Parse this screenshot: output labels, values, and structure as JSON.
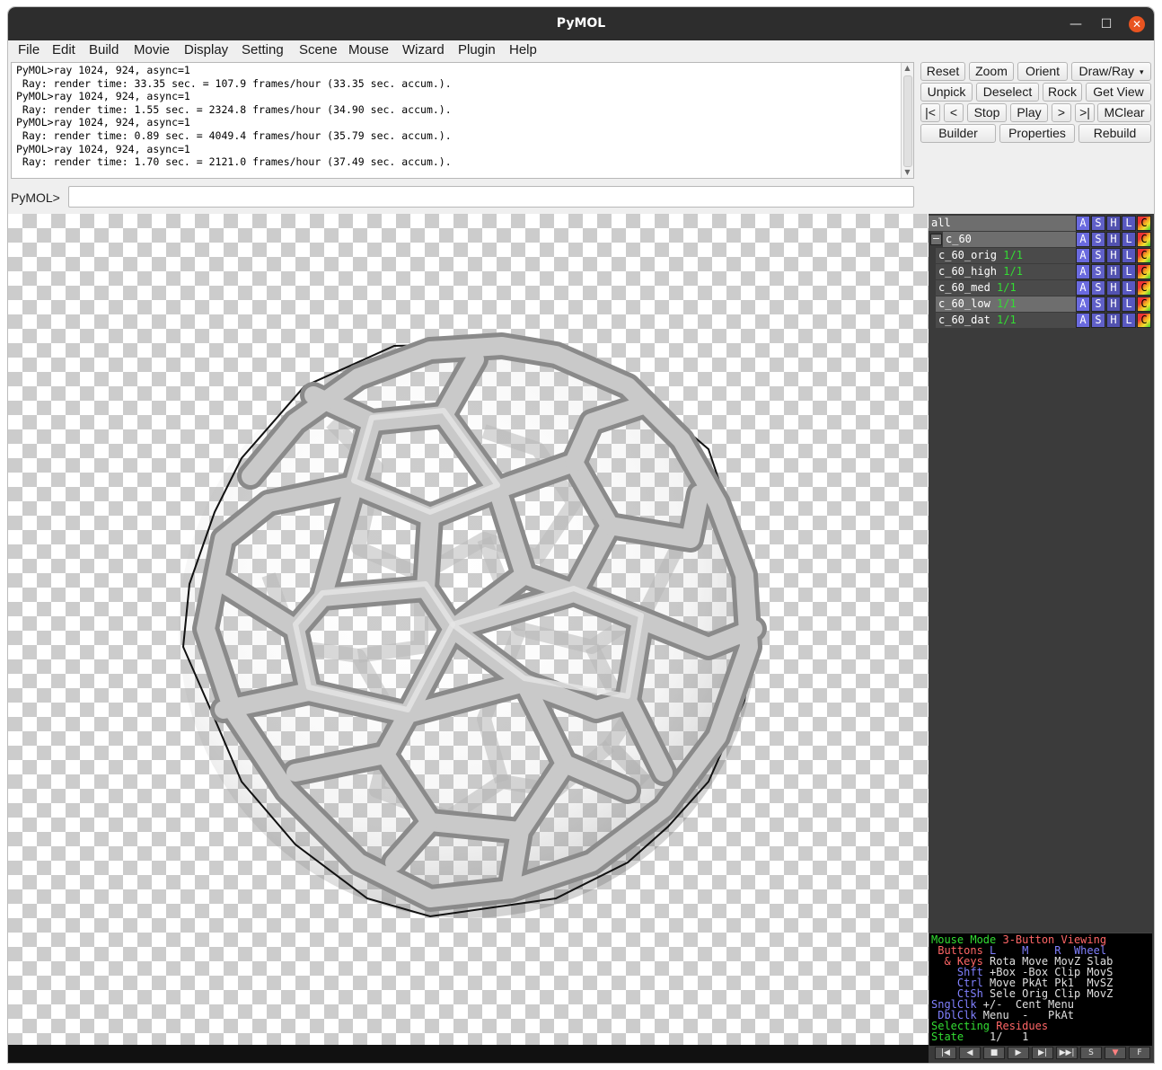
{
  "window": {
    "title": "PyMOL"
  },
  "menubar": [
    "File",
    "Edit",
    "Build",
    "Movie",
    "Display",
    "Setting",
    "Scene",
    "Mouse",
    "Wizard",
    "Plugin",
    "Help"
  ],
  "console": {
    "lines": [
      "PyMOL>ray 1024, 924, async=1",
      " Ray: render time: 33.35 sec. = 107.9 frames/hour (33.35 sec. accum.).",
      "PyMOL>ray 1024, 924, async=1",
      " Ray: render time: 1.55 sec. = 2324.8 frames/hour (34.90 sec. accum.).",
      "PyMOL>ray 1024, 924, async=1",
      " Ray: render time: 0.89 sec. = 4049.4 frames/hour (35.79 sec. accum.).",
      "PyMOL>ray 1024, 924, async=1",
      " Ray: render time: 1.70 sec. = 2121.0 frames/hour (37.49 sec. accum.)."
    ]
  },
  "prompt": {
    "label": "PyMOL>",
    "value": ""
  },
  "buttons": {
    "reset": "Reset",
    "zoom": "Zoom",
    "orient": "Orient",
    "draw_ray": "Draw/Ray",
    "unpick": "Unpick",
    "deselect": "Deselect",
    "rock": "Rock",
    "get_view": "Get View",
    "first": "|<",
    "prev": "<",
    "stop": "Stop",
    "play": "Play",
    "next": ">",
    "last": ">|",
    "mclear": "MClear",
    "builder": "Builder",
    "properties": "Properties",
    "rebuild": "Rebuild"
  },
  "objects": {
    "all": "all",
    "group": "c_60",
    "items": [
      {
        "name": "c_60_orig",
        "state": "1/1"
      },
      {
        "name": "c_60_high",
        "state": "1/1"
      },
      {
        "name": "c_60_med",
        "state": "1/1"
      },
      {
        "name": "c_60_low",
        "state": "1/1"
      },
      {
        "name": "c_60_dat",
        "state": "1/1"
      }
    ],
    "action_letters": [
      "A",
      "S",
      "H",
      "L",
      "C"
    ]
  },
  "mouse_info": {
    "line1a": "Mouse Mode ",
    "line1b": "3-Button Viewing",
    "line2a": " Buttons ",
    "line2b": "L    M    R  Wheel",
    "line3a": "  & Keys ",
    "line3b": "Rota Move MovZ Slab",
    "line4a": "    Shft ",
    "line4b": "+Box -Box Clip MovS",
    "line5a": "    Ctrl ",
    "line5b": "Move PkAt Pk1  MvSZ",
    "line6a": "    CtSh ",
    "line6b": "Sele Orig Clip MovZ",
    "line7a": "SnglClk ",
    "line7b": "+/-  Cent Menu",
    "line8a": " DblClk ",
    "line8b": "Menu  -   PkAt",
    "line9a": "Selecting ",
    "line9b": "Residues",
    "line10a": "State ",
    "line10b": "   1/   1"
  },
  "transport": [
    "|◀",
    "◀",
    "■",
    "▶",
    "▶|",
    "▶▶|",
    "S",
    "▼",
    "F"
  ],
  "colors": {
    "titlebar": "#2d2d2d",
    "close": "#e95420",
    "panel": "#3b3b3b",
    "state_green": "#33dd33"
  }
}
